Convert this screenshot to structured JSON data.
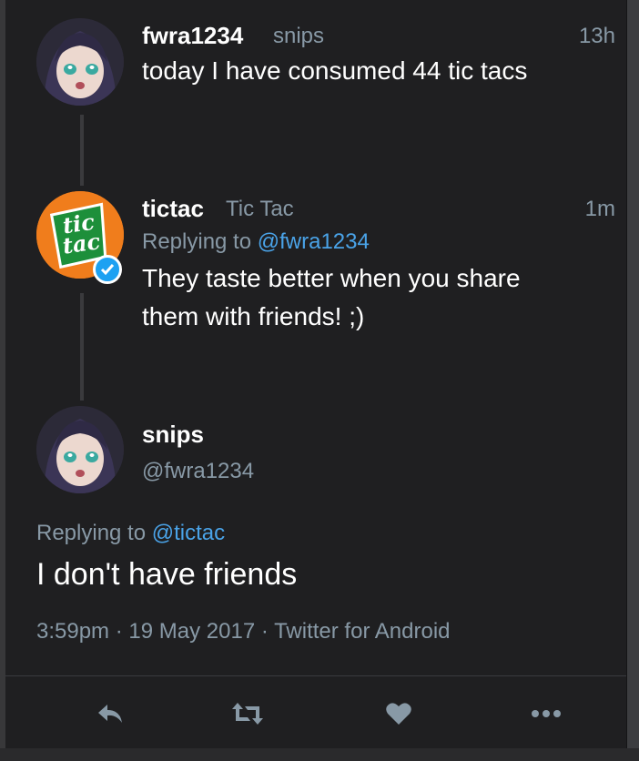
{
  "tweet1": {
    "name": "fwra1234",
    "handle": "snips",
    "time": "13h",
    "text": "today I have consumed 44 tic tacs"
  },
  "tweet2": {
    "name": "tictac",
    "handle": "Tic Tac",
    "time": "1m",
    "replying_prefix": "Replying to",
    "replying_to": "@fwra1234",
    "text_line1": "They taste better when you share",
    "text_line2": "them with friends! ;)",
    "logo_text_1": "tic",
    "logo_text_2": "tac"
  },
  "main_tweet": {
    "name": "snips",
    "handle": "@fwra1234",
    "replying_prefix": "Replying to",
    "replying_to": "@tictac",
    "text": "I don't have friends",
    "time": "3:59pm",
    "date": "19 May 2017",
    "source": "Twitter for Android",
    "separator": "·"
  },
  "actions": {
    "icons": [
      "reply-icon",
      "retweet-icon",
      "like-icon",
      "more-icon"
    ]
  },
  "colors": {
    "background": "#1f1f21",
    "muted": "#8899a6",
    "link": "#4aa3e8",
    "tictac_orange": "#f07d1c",
    "tictac_green": "#1d8f3a"
  }
}
